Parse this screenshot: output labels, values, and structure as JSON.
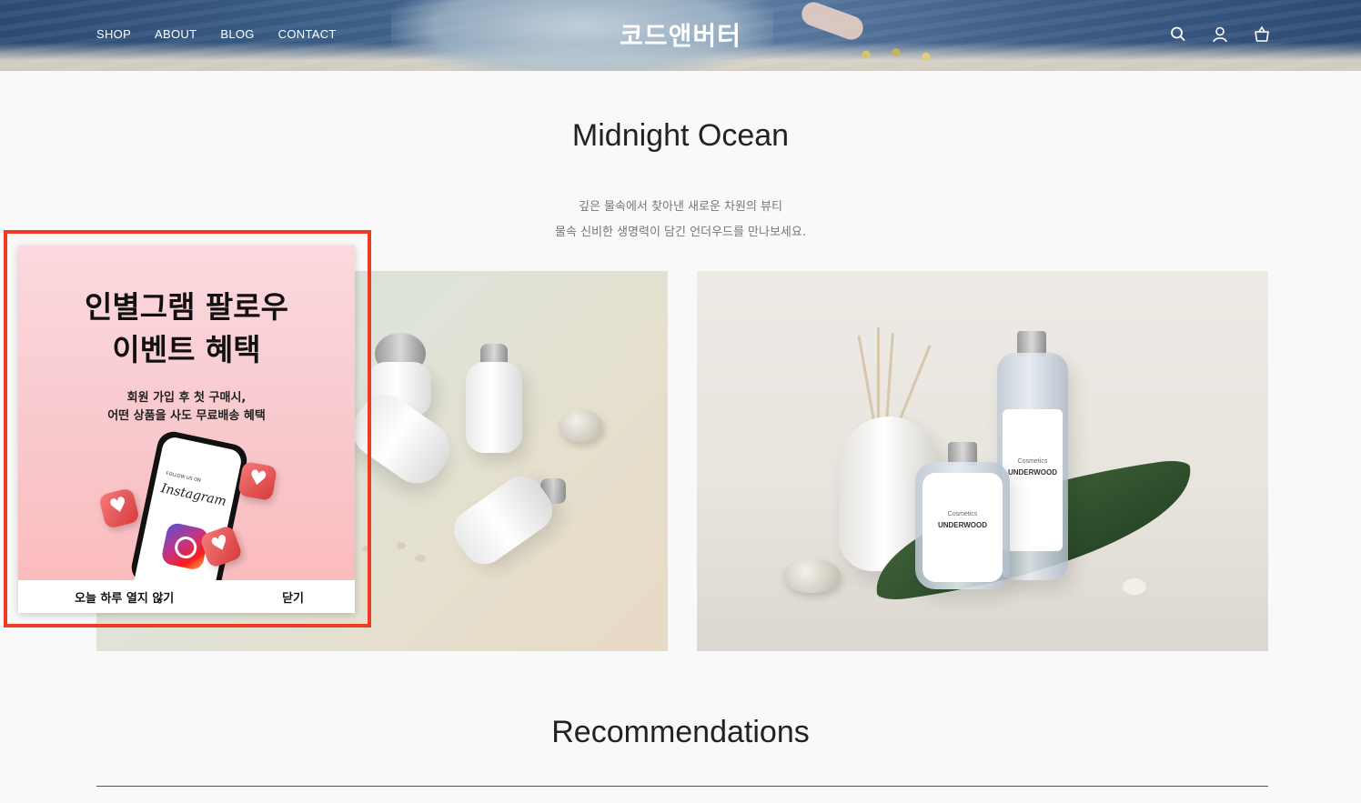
{
  "header": {
    "nav": [
      {
        "label": "SHOP"
      },
      {
        "label": "ABOUT"
      },
      {
        "label": "BLOG"
      },
      {
        "label": "CONTACT"
      }
    ],
    "logo": "코드앤버터",
    "icons": [
      "search-icon",
      "user-icon",
      "shopping-bag-icon"
    ]
  },
  "hero": {
    "title": "Midnight Ocean",
    "subtitle_line1": "깊은 물속에서 찾아낸 새로운 차원의 뷰티",
    "subtitle_line2": "물속 신비한 생명력이 담긴 언더우드를 만나보세요."
  },
  "products": {
    "label_small": "Cosmetics",
    "label_brand": "UNDERWOOD"
  },
  "popup": {
    "title_line1": "인별그램 팔로우",
    "title_line2": "이벤트 혜택",
    "desc_line1": "회원 가입 후 첫 구매시,",
    "desc_line2": "어떤 상품을 사도 무료배송 혜택",
    "phone_follow": "FOLLOW US ON",
    "phone_brand": "Instagram",
    "dont_show_today": "오늘 하루 열지 않기",
    "close": "닫기",
    "highlight_color": "#ee3b24"
  },
  "recommendations": {
    "title": "Recommendations"
  }
}
